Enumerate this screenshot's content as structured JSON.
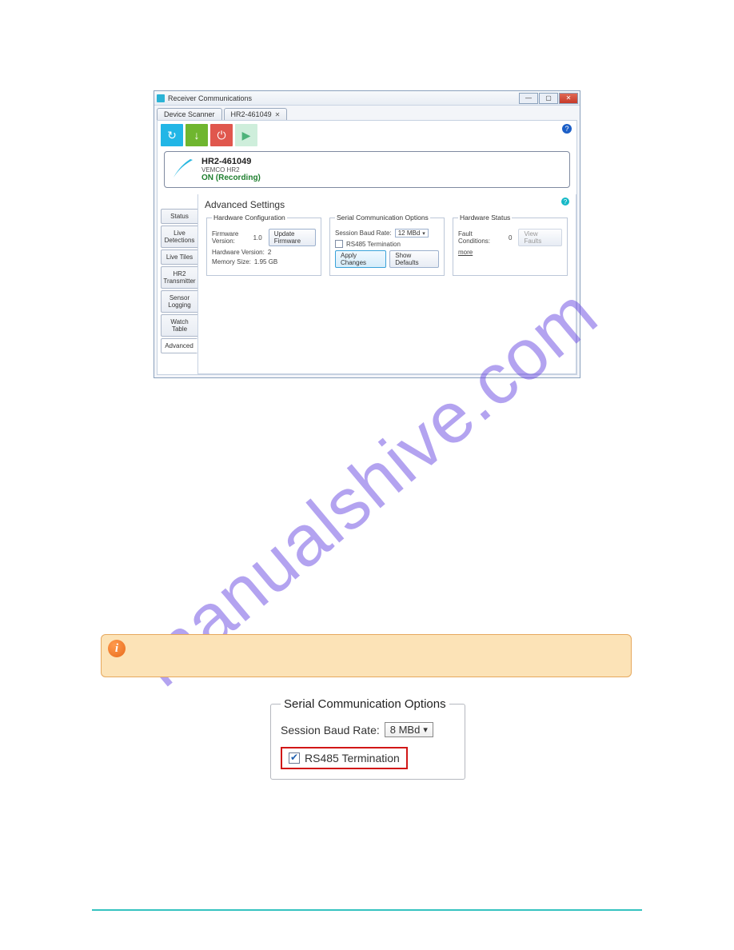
{
  "watermark": "manualshive.com",
  "app": {
    "title": "Receiver Communications",
    "tabs": {
      "scanner": "Device Scanner",
      "device": "HR2-461049"
    },
    "help_glyph": "?"
  },
  "toolbar": {
    "refresh_glyph": "↻",
    "download_glyph": "↓",
    "power_glyph": "⏻",
    "play_glyph": "▶"
  },
  "device": {
    "name": "HR2-461049",
    "model": "VEMCO HR2",
    "status": "ON (Recording)"
  },
  "sidetabs": {
    "status": "Status",
    "live_detections": "Live Detections",
    "live_tiles": "Live Tiles",
    "hr2_transmitter": "HR2 Transmitter",
    "sensor_logging": "Sensor Logging",
    "watch_table": "Watch Table",
    "advanced": "Advanced"
  },
  "settings": {
    "title": "Advanced Settings",
    "hw_config": {
      "legend": "Hardware Configuration",
      "firmware_label": "Firmware Version:",
      "firmware_value": "1.0",
      "update_firmware": "Update Firmware",
      "hardware_label": "Hardware Version:",
      "hardware_value": "2",
      "memory_label": "Memory Size:",
      "memory_value": "1.95 GB"
    },
    "serial": {
      "legend": "Serial Communication Options",
      "baud_label": "Session Baud Rate:",
      "baud_value": "12 MBd",
      "rs485_label": "RS485 Termination",
      "apply": "Apply Changes",
      "show_defaults": "Show Defaults"
    },
    "hw_status": {
      "legend": "Hardware Status",
      "fault_label": "Fault Conditions:",
      "fault_value": "0",
      "view_faults": "View Faults",
      "more": "more"
    }
  },
  "sco_detail": {
    "legend": "Serial Communication Options",
    "baud_label": "Session Baud Rate:",
    "baud_value": "8 MBd",
    "rs485_label": "RS485 Termination"
  }
}
